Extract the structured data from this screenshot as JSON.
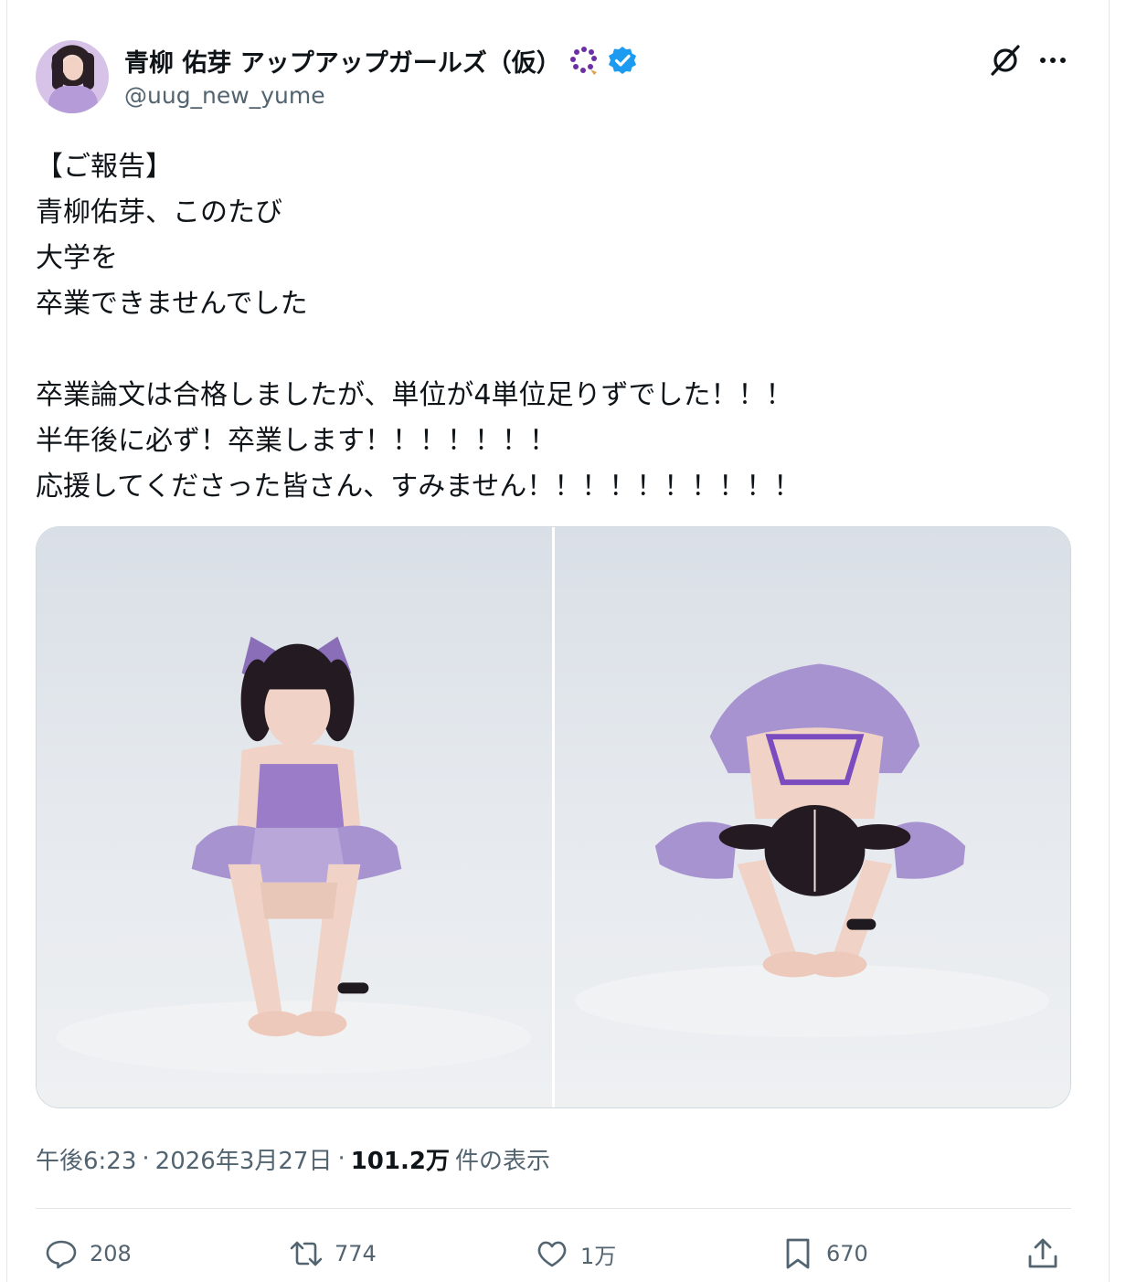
{
  "author": {
    "display_name": "青柳 佑芽 アップアップガールズ（仮）",
    "handle": "@uug_new_yume",
    "verified": true,
    "badge_icon": "prayer-beads-icon"
  },
  "post": {
    "lines": [
      "【ご報告】",
      "青柳佑芽、このたび",
      "大学を",
      "卒業できませんでした",
      "",
      "卒業論文は合格しましたが、単位が4単位足りずでした！！！",
      "半年後に必ず！卒業します！！！！！！！",
      "応援してくださった皆さん、すみません！！！！！！！！！！"
    ]
  },
  "media": {
    "count": 2,
    "items": [
      {
        "icon": "photo-kneeling"
      },
      {
        "icon": "photo-bowing"
      }
    ],
    "colors": {
      "costume": "#9a7cc9",
      "hair": "#241b22",
      "skin": "#f0d3c6",
      "background": "#e4e8ec"
    }
  },
  "meta": {
    "time": "午後6:23",
    "separator": "·",
    "date": "2026年3月27日",
    "views_count": "101.2万",
    "views_label": "件の表示"
  },
  "actions": {
    "replies": "208",
    "reposts": "774",
    "likes": "1万",
    "bookmarks": "670"
  },
  "colors": {
    "text": "#0f1419",
    "secondary": "#536471",
    "verified": "#1d9bf0",
    "border": "#cfd9de"
  }
}
